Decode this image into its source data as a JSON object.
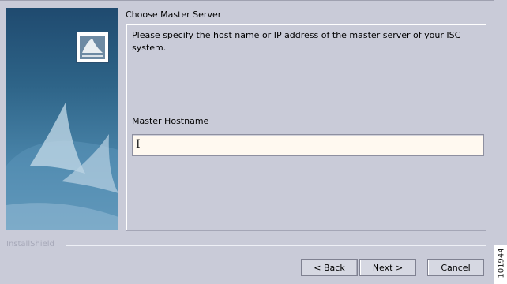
{
  "wizard": {
    "step_title": "Choose Master Server",
    "description": "Please specify the host name or IP address of the master server of your ISC system.",
    "field_label": "Master Hostname",
    "hostname_value": "",
    "brand_label": "InstallShield"
  },
  "buttons": {
    "back": "< Back",
    "next": "Next >",
    "cancel": "Cancel"
  },
  "figure_id": "101944",
  "icons": {
    "logo": "installer-logo-icon",
    "cursor": "text-cursor-icon"
  },
  "colors": {
    "background": "#c9cbd8",
    "input_background": "#fff9f0",
    "side_panel": "#2e6488"
  }
}
